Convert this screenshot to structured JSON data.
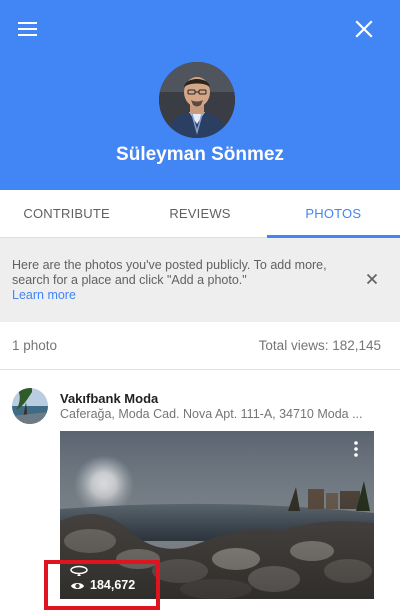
{
  "header": {
    "menu_icon": "hamburger-menu-icon",
    "close_icon": "close-icon",
    "profile_name": "Süleyman Sönmez",
    "bg_color": "#4285f4"
  },
  "tabs": [
    {
      "label": "CONTRIBUTE",
      "active": false
    },
    {
      "label": "REVIEWS",
      "active": false
    },
    {
      "label": "PHOTOS",
      "active": true
    }
  ],
  "banner": {
    "text": "Here are the photos you've posted publicly. To add more, search for a place and click \"Add a photo.\"",
    "link": "Learn more",
    "close_icon": "close-icon"
  },
  "stats": {
    "photo_count": "1 photo",
    "total_views": "Total views: 182,145"
  },
  "place": {
    "name": "Vakıfbank Moda",
    "address": "Caferağa, Moda Cad. Nova Apt. 111-A, 34710 Moda ...",
    "photo": {
      "more_icon": "more-vert-icon",
      "pano_icon": "panorama-360-icon",
      "eye_icon": "eye-icon",
      "views": "184,672",
      "highlight_color": "#e0141e"
    }
  }
}
